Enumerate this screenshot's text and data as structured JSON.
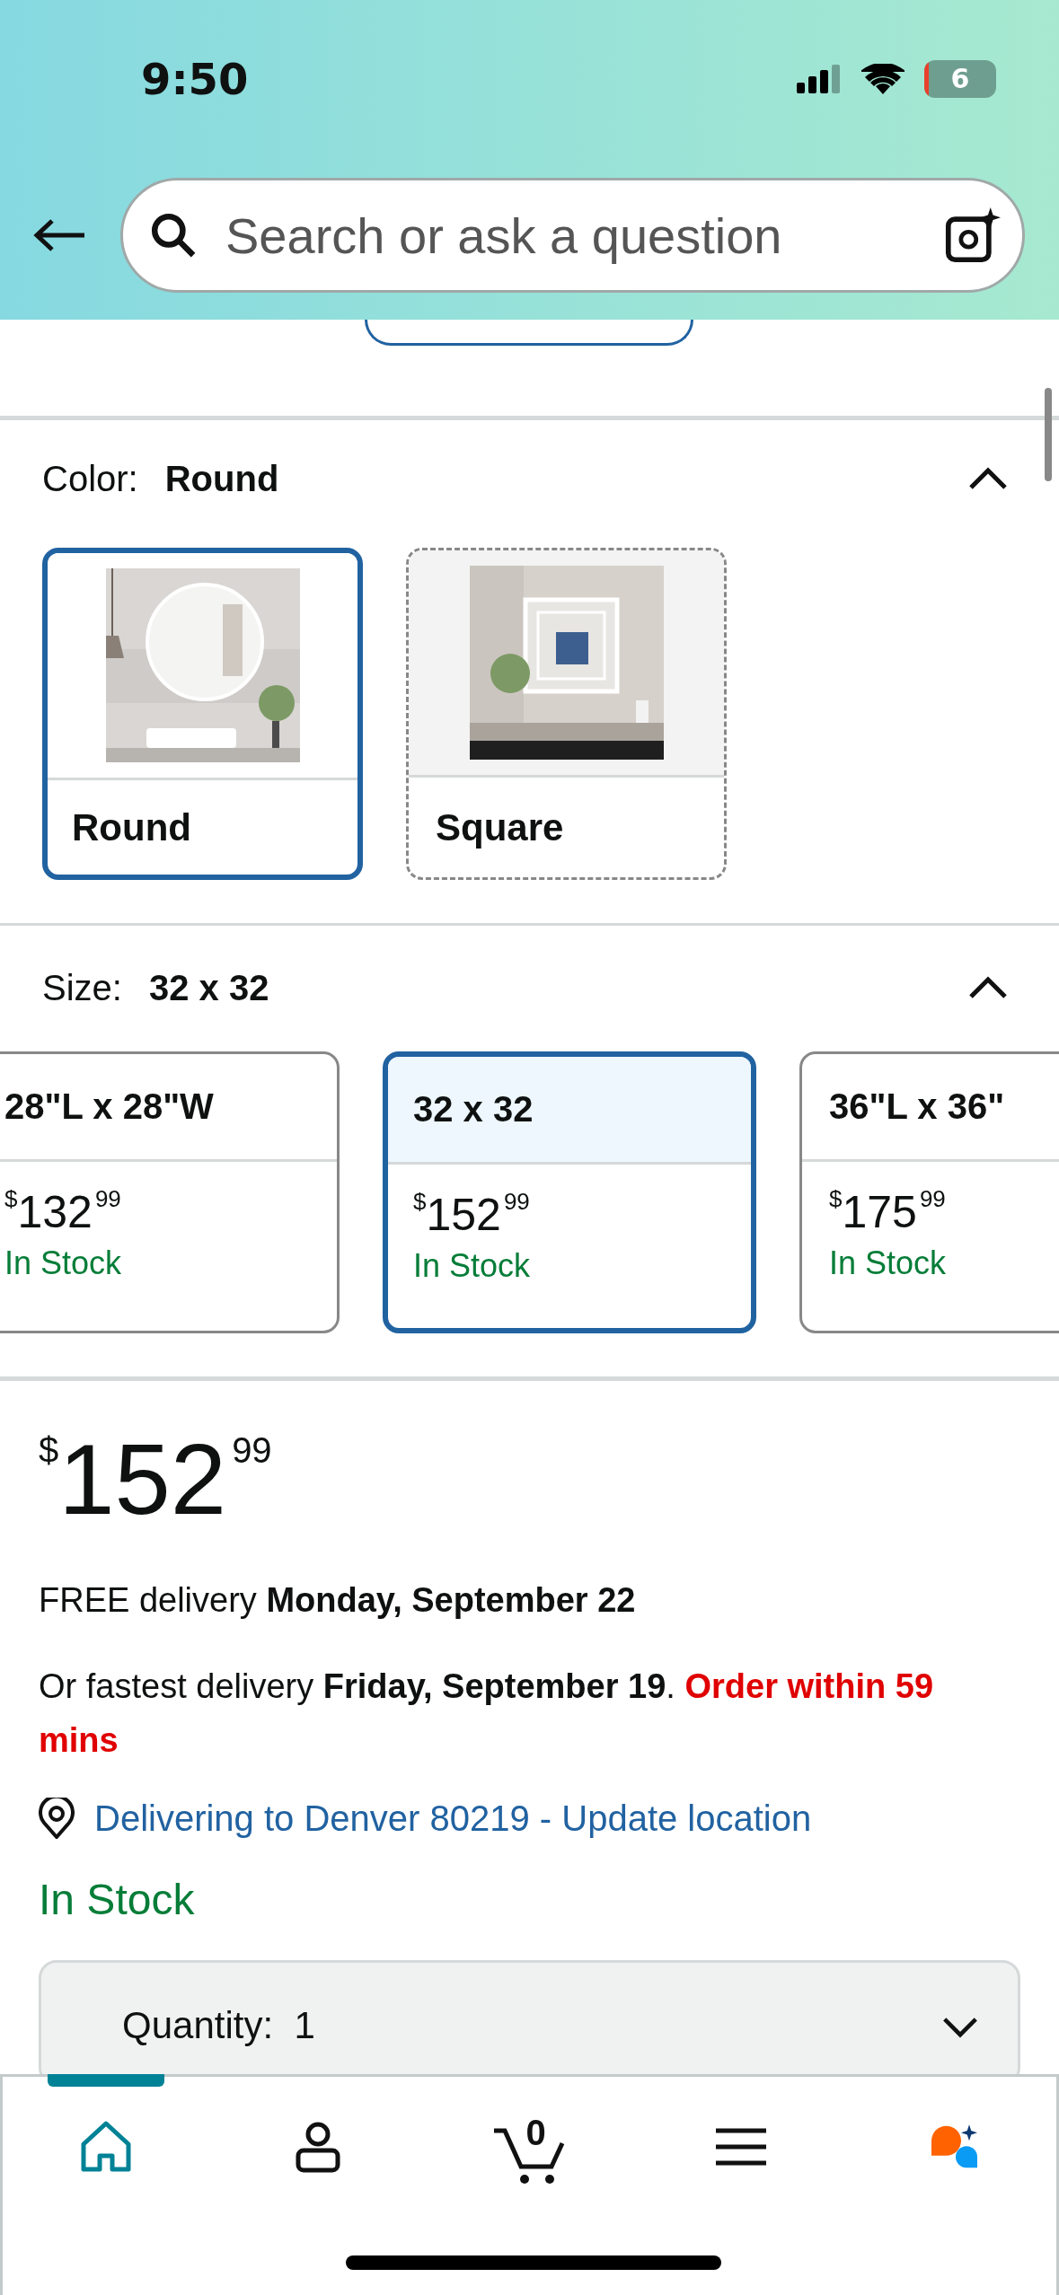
{
  "status_bar": {
    "time": "9:50",
    "battery_label": "6"
  },
  "search": {
    "placeholder": "Search or ask a question"
  },
  "color_option": {
    "label": "Color:",
    "value": "Round",
    "expanded": true,
    "swatches": [
      {
        "label": "Round",
        "selected": true,
        "available": true,
        "kind": "round"
      },
      {
        "label": "Square",
        "selected": false,
        "available": false,
        "kind": "square"
      }
    ]
  },
  "size_option": {
    "label": "Size:",
    "value": "32 x 32",
    "expanded": true,
    "sizes": [
      {
        "label": "28\"L x 28\"W",
        "price": {
          "symbol": "$",
          "whole": "132",
          "fraction": "99"
        },
        "stock": "In Stock",
        "selected": false
      },
      {
        "label": "32 x 32",
        "price": {
          "symbol": "$",
          "whole": "152",
          "fraction": "99"
        },
        "stock": "In Stock",
        "selected": true
      },
      {
        "label": "36\"L x 36\"",
        "price": {
          "symbol": "$",
          "whole": "175",
          "fraction": "99"
        },
        "stock": "In Stock",
        "selected": false
      }
    ]
  },
  "price": {
    "symbol": "$",
    "whole": "152",
    "fraction": "99"
  },
  "delivery": "FREE delivery **Monday, September 22**",
  "fastest_delivery": "Or fastest delivery **Friday, September 19**.",
  "order_deadline": "Order within 59 mins",
  "location": "Delivering to Denver 80219 - Update location",
  "availability": "In Stock",
  "quantity": {
    "label": "Quantity:",
    "value": "1"
  },
  "nav": [
    {
      "kind": "home",
      "selected": true
    },
    {
      "kind": "account",
      "selected": false
    },
    {
      "kind": "cart",
      "selected": false,
      "count": "0"
    },
    {
      "kind": "menu",
      "selected": false
    },
    {
      "kind": "assistant",
      "selected": false
    }
  ]
}
